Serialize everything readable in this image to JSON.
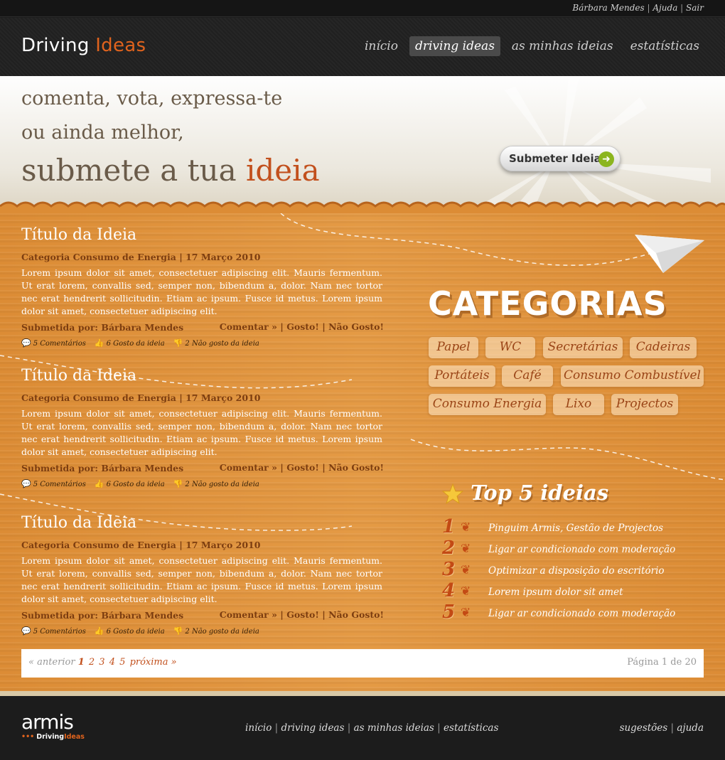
{
  "top_bar": {
    "user": "Bárbara Mendes",
    "help": "Ajuda",
    "logout": "Sair",
    "separator": "|"
  },
  "brand": {
    "name_part1": "Driving",
    "name_part2": "Ideas",
    "accent_color": "#e0631d"
  },
  "nav": {
    "items": [
      "início",
      "driving ideas",
      "as minhas ideias",
      "estatísticas"
    ],
    "active": "driving ideas"
  },
  "hero": {
    "line1": "comenta, vota, expressa-te",
    "line2": "ou ainda melhor,",
    "line3_prefix": "submete a tua",
    "line3_accent": "ideia",
    "submit_button": "Submeter Ideia",
    "submit_icon": "arrow-right-icon"
  },
  "ideas": [
    {
      "title": "Título da Ideia",
      "meta": "Categoria Consumo de Energia | 17 Março 2010",
      "body": "Lorem ipsum dolor sit amet, consectetuer adipiscing elit. Mauris fermentum. Ut erat lorem, convallis sed, semper non, bibendum a, dolor. Nam nec tortor nec erat hendrerit sollicitudin. Etiam ac ipsum. Fusce id metus. Lorem ipsum dolor sit amet, consectetuer adipiscing elit.",
      "author": "Submetida por: Bárbara Mendes",
      "comment_link": "Comentar »",
      "like_link": "Gosto!",
      "dislike_link": "Não Gosto!",
      "comments": "5 Comentários",
      "likes": "6 Gosto da ideia",
      "dislikes": "2 Não gosto da ideia"
    },
    {
      "title": "Título da Ideia",
      "meta": "Categoria Consumo de Energia | 17 Março 2010",
      "body": "Lorem ipsum dolor sit amet, consectetuer adipiscing elit. Mauris fermentum. Ut erat lorem, convallis sed, semper non, bibendum a, dolor. Nam nec tortor nec erat hendrerit sollicitudin. Etiam ac ipsum. Fusce id metus. Lorem ipsum dolor sit amet, consectetuer adipiscing elit.",
      "author": "Submetida por: Bárbara Mendes",
      "comment_link": "Comentar »",
      "like_link": "Gosto!",
      "dislike_link": "Não Gosto!",
      "comments": "5 Comentários",
      "likes": "6 Gosto da ideia",
      "dislikes": "2 Não gosto da ideia"
    },
    {
      "title": "Título da Ideia",
      "meta": "Categoria Consumo de Energia | 17 Março 2010",
      "body": "Lorem ipsum dolor sit amet, consectetuer adipiscing elit. Mauris fermentum. Ut erat lorem, convallis sed, semper non, bibendum a, dolor. Nam nec tortor nec erat hendrerit sollicitudin. Etiam ac ipsum. Fusce id metus. Lorem ipsum dolor sit amet, consectetuer adipiscing elit.",
      "author": "Submetida por: Bárbara Mendes",
      "comment_link": "Comentar »",
      "like_link": "Gosto!",
      "dislike_link": "Não Gosto!",
      "comments": "5 Comentários",
      "likes": "6 Gosto da ideia",
      "dislikes": "2 Não gosto da ideia"
    }
  ],
  "categories": {
    "heading": "CATEGORIAS",
    "tags": [
      "Papel",
      "WC",
      "Secretárias",
      "Cadeiras",
      "Portáteis",
      "Café",
      "Consumo Combustível",
      "Consumo Energia",
      "Lixo",
      "Projectos"
    ]
  },
  "top5": {
    "heading": "Top 5 ideias",
    "icon": "star-icon",
    "items": [
      {
        "rank": "1",
        "text": "Pinguim Armis, Gestão de Projectos"
      },
      {
        "rank": "2",
        "text": "Ligar ar condicionado com moderação"
      },
      {
        "rank": "3",
        "text": "Optimizar a disposição do escritório"
      },
      {
        "rank": "4",
        "text": "Lorem ipsum dolor sit amet"
      },
      {
        "rank": "5",
        "text": "Ligar ar condicionado com moderação"
      }
    ]
  },
  "pagination": {
    "prev": "« anterior",
    "pages": [
      "1",
      "2",
      "3",
      "4",
      "5"
    ],
    "current": "1",
    "next": "próxima »",
    "summary": "Página 1 de 20"
  },
  "footer": {
    "logo_main": "armis",
    "logo_sub_part1": "Driving",
    "logo_sub_part2": "Ideas",
    "nav": [
      "início",
      "driving ideas",
      "as minhas ideias",
      "estatísticas"
    ],
    "right_links": [
      "sugestões",
      "ajuda"
    ]
  }
}
